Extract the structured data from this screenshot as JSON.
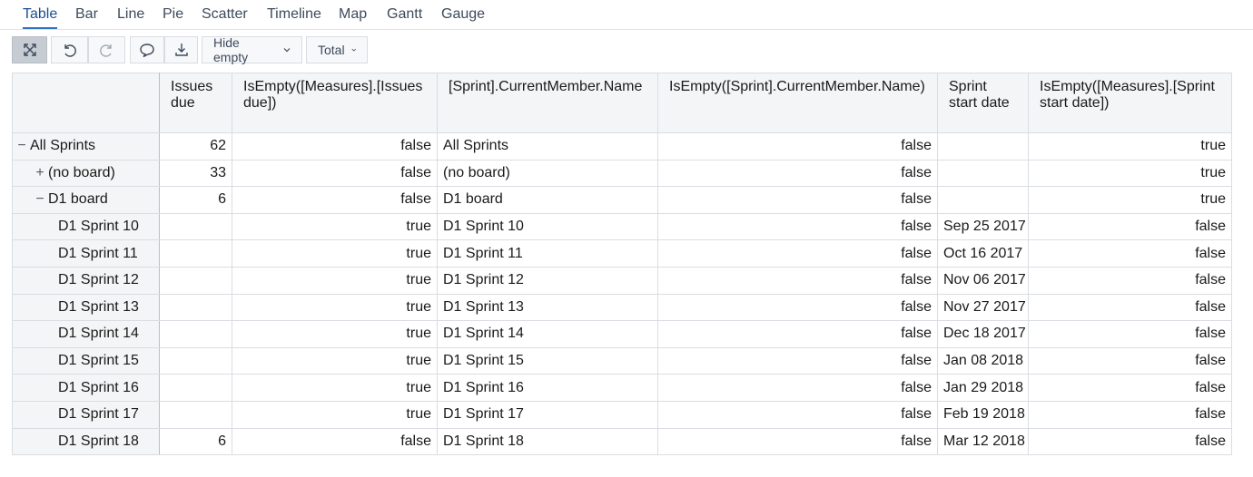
{
  "tabs": [
    "Table",
    "Bar",
    "Line",
    "Pie",
    "Scatter",
    "Timeline",
    "Map",
    "Gantt",
    "Gauge"
  ],
  "active_tab": "Table",
  "toolbar": {
    "hide_empty_label": "Hide empty",
    "total_label": "Total"
  },
  "table": {
    "headers": [
      "Issues due",
      "IsEmpty([Measures].[Issues due])",
      "[Sprint].CurrentMember.Name",
      "IsEmpty([Sprint].CurrentMember.Name)",
      "Sprint start date",
      "IsEmpty([Measures].[Sprint start date])"
    ],
    "rows": [
      {
        "label": "All Sprints",
        "toggle": "−",
        "level": 0,
        "cells": [
          "62",
          "false",
          "All Sprints",
          "false",
          "",
          "true"
        ]
      },
      {
        "label": "(no board)",
        "toggle": "+",
        "level": 1,
        "cells": [
          "33",
          "false",
          "(no board)",
          "false",
          "",
          "true"
        ]
      },
      {
        "label": "D1 board",
        "toggle": "−",
        "level": 1,
        "cells": [
          "6",
          "false",
          "D1 board",
          "false",
          "",
          "true"
        ]
      },
      {
        "label": "D1 Sprint 10",
        "toggle": "",
        "level": 2,
        "cells": [
          "",
          "true",
          "D1 Sprint 10",
          "false",
          "Sep 25 2017",
          "false"
        ]
      },
      {
        "label": "D1 Sprint 11",
        "toggle": "",
        "level": 2,
        "cells": [
          "",
          "true",
          "D1 Sprint 11",
          "false",
          "Oct 16 2017",
          "false"
        ]
      },
      {
        "label": "D1 Sprint 12",
        "toggle": "",
        "level": 2,
        "cells": [
          "",
          "true",
          "D1 Sprint 12",
          "false",
          "Nov 06 2017",
          "false"
        ]
      },
      {
        "label": "D1 Sprint 13",
        "toggle": "",
        "level": 2,
        "cells": [
          "",
          "true",
          "D1 Sprint 13",
          "false",
          "Nov 27 2017",
          "false"
        ]
      },
      {
        "label": "D1 Sprint 14",
        "toggle": "",
        "level": 2,
        "cells": [
          "",
          "true",
          "D1 Sprint 14",
          "false",
          "Dec 18 2017",
          "false"
        ]
      },
      {
        "label": "D1 Sprint 15",
        "toggle": "",
        "level": 2,
        "cells": [
          "",
          "true",
          "D1 Sprint 15",
          "false",
          "Jan 08 2018",
          "false"
        ]
      },
      {
        "label": "D1 Sprint 16",
        "toggle": "",
        "level": 2,
        "cells": [
          "",
          "true",
          "D1 Sprint 16",
          "false",
          "Jan 29 2018",
          "false"
        ]
      },
      {
        "label": "D1 Sprint 17",
        "toggle": "",
        "level": 2,
        "cells": [
          "",
          "true",
          "D1 Sprint 17",
          "false",
          "Feb 19 2018",
          "false"
        ]
      },
      {
        "label": "D1 Sprint 18",
        "toggle": "",
        "level": 2,
        "cells": [
          "6",
          "false",
          "D1 Sprint 18",
          "false",
          "Mar 12 2018",
          "false"
        ]
      }
    ]
  },
  "icons": [
    "fullscreen-icon",
    "undo-icon",
    "redo-icon",
    "comment-icon",
    "download-icon",
    "chevron-down-icon"
  ]
}
